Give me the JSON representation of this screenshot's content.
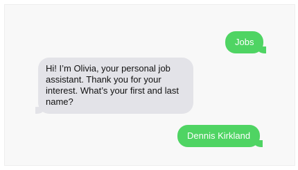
{
  "conversation": {
    "messages": [
      {
        "sender": "user",
        "text": "Jobs"
      },
      {
        "sender": "assistant",
        "text": "Hi! I’m Olivia, your personal job assistant. Thank you for your interest. What’s your first and last name?"
      },
      {
        "sender": "user",
        "text": "Dennis Kirkland"
      }
    ]
  },
  "colors": {
    "sent_bubble": "#4fd463",
    "received_bubble": "#e3e3e8",
    "background": "#f8f8f8"
  }
}
